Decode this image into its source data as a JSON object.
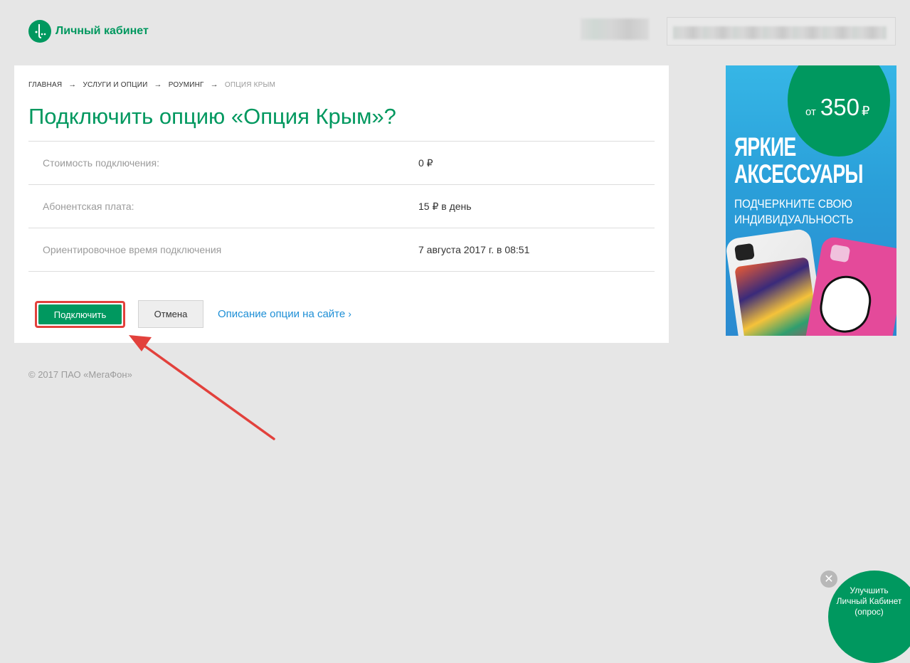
{
  "header": {
    "logo_text": "Личный кабинет"
  },
  "breadcrumbs": [
    "Главная",
    "Услуги и опции",
    "Роуминг",
    "Опция Крым"
  ],
  "page_title": "Подключить опцию «Опция Крым»?",
  "details": [
    {
      "label": "Стоимость подключения:",
      "value": "0 ₽"
    },
    {
      "label": "Абонентская плата:",
      "value": "15 ₽ в день"
    },
    {
      "label": "Ориентировочное время подключения",
      "value": "7 августа 2017 г. в 08:51"
    }
  ],
  "actions": {
    "connect_label": "Подключить",
    "cancel_label": "Отмена",
    "description_link": "Описание опции на сайте"
  },
  "footer": {
    "copyright": "© 2017 ПАО «МегаФон»"
  },
  "ad": {
    "price_prefix": "от",
    "price": "350",
    "currency": "₽",
    "headline_1": "ЯРКИЕ",
    "headline_2": "АКСЕССУАРЫ",
    "subline_1": "ПОДЧЕРКНИТЕ СВОЮ",
    "subline_2": "ИНДИВИДУАЛЬНОСТЬ"
  },
  "survey": {
    "line1": "Улучшить",
    "line2": "Личный Кабинет",
    "line3": "(опрос)"
  },
  "colors": {
    "brand_green": "#00985f",
    "link_blue": "#1e8fd6",
    "highlight_red": "#e2413c"
  }
}
